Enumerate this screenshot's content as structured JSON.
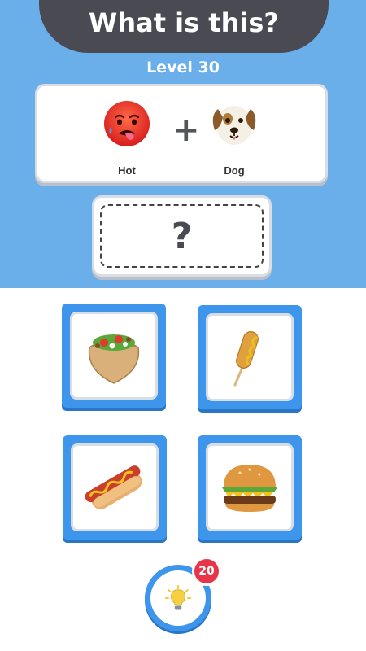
{
  "header": {
    "title": "What is this?",
    "level": "Level 30"
  },
  "clue": {
    "left": {
      "emoji": "hot-face-emoji",
      "label": "Hot"
    },
    "operator": "+",
    "right": {
      "emoji": "dog-face-emoji",
      "label": "Dog"
    }
  },
  "answer": {
    "placeholder": "?"
  },
  "options": [
    {
      "name": "pita-falafel-option",
      "icon": "stuffed-flatbread-icon"
    },
    {
      "name": "corn-dog-option",
      "icon": "corn-dog-icon"
    },
    {
      "name": "hot-dog-option",
      "icon": "hot-dog-icon"
    },
    {
      "name": "hamburger-option",
      "icon": "hamburger-icon"
    }
  ],
  "hint": {
    "icon": "lightbulb-icon",
    "count": "20"
  },
  "colors": {
    "background_top": "#6aaeea",
    "banner": "#4a4a52",
    "option_frame": "#3d95ec",
    "badge": "#e8354a"
  }
}
